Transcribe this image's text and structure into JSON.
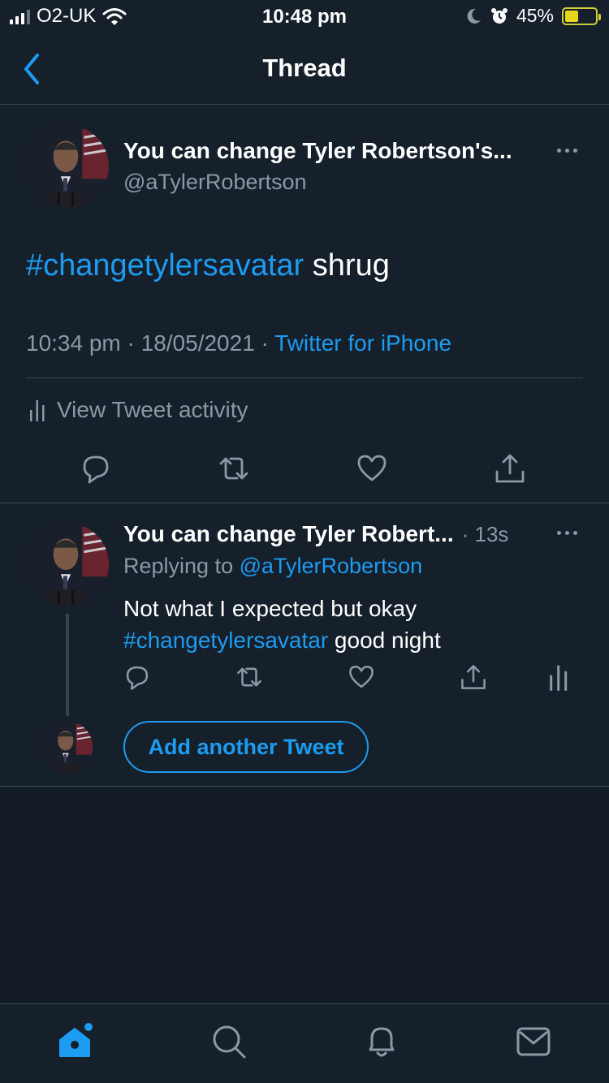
{
  "status_bar": {
    "carrier": "O2-UK",
    "time": "10:48 pm",
    "battery_percent": "45%",
    "battery_level": 0.45,
    "icons": [
      "signal-icon",
      "wifi-icon",
      "moon-icon",
      "alarm-icon",
      "battery-icon"
    ]
  },
  "nav": {
    "title": "Thread",
    "back_icon": "chevron-left-icon"
  },
  "main_tweet": {
    "display_name": "You can change Tyler Robertson's...",
    "handle": "@aTylerRobertson",
    "hashtag": "#changetylersavatar",
    "text_rest": " shrug",
    "timestamp": "10:34 pm · 18/05/2021 · ",
    "source": "Twitter for iPhone",
    "activity_label": "View Tweet activity",
    "actions": [
      "reply-icon",
      "retweet-icon",
      "like-icon",
      "share-icon"
    ]
  },
  "reply": {
    "display_name": "You can change Tyler Robert...",
    "time": "· 13s",
    "replying_prefix": "Replying to ",
    "replying_handle": "@aTylerRobertson",
    "text_line1": "Not what I expected but okay",
    "hashtag": "#changetylersavatar",
    "text_rest": " good night",
    "actions": [
      "reply-icon",
      "retweet-icon",
      "like-icon",
      "share-icon",
      "analytics-icon"
    ]
  },
  "compose": {
    "add_button_label": "Add another Tweet"
  },
  "tabbar": {
    "tabs": [
      "home-icon",
      "search-icon",
      "notifications-icon",
      "messages-icon"
    ],
    "accent": "#1d9bf0"
  },
  "colors": {
    "background": "#15202b",
    "accent": "#1d9bf0",
    "secondary_text": "#8b98a5",
    "border": "#38444d"
  }
}
